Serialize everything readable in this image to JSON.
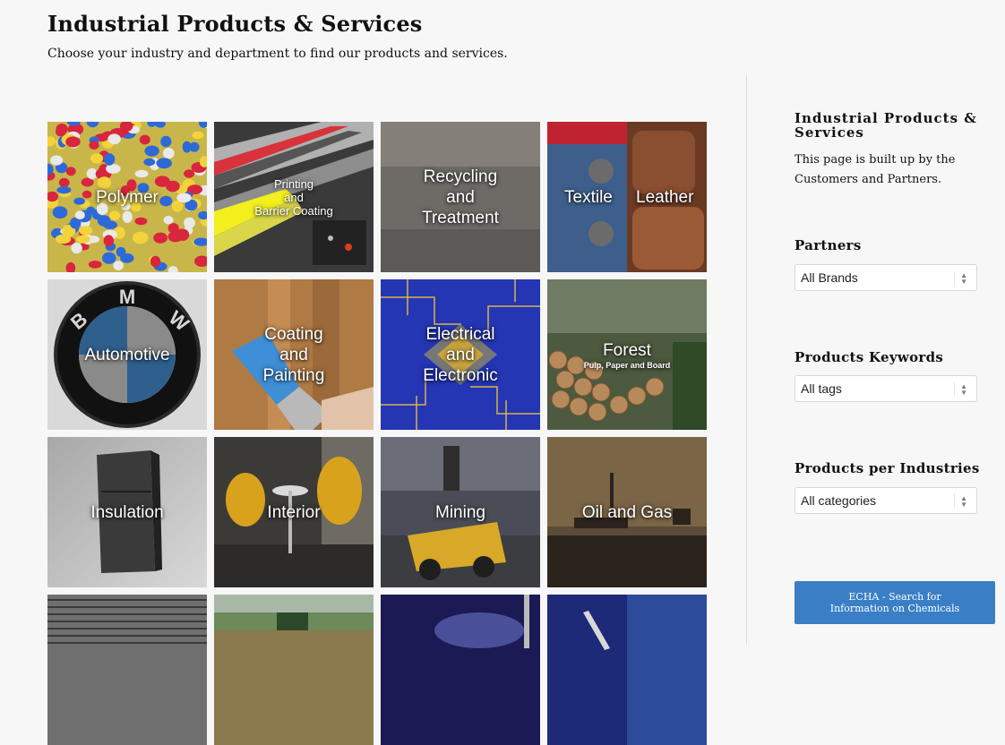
{
  "header": {
    "title": "Industrial Products & Services",
    "subtitle": "Choose your industry and department to find our products and services."
  },
  "tiles": [
    {
      "label": "Polymer"
    },
    {
      "label": "Printing\nand\nBarrier Coating"
    },
    {
      "label": "Recycling\nand\nTreatment"
    },
    {
      "label_left": "Textile",
      "label_right": "Leather"
    },
    {
      "label": "Automotive",
      "logo_text": "BMW"
    },
    {
      "label": "Coating\nand\nPainting"
    },
    {
      "label": "Electrical\nand\nElectronic"
    },
    {
      "label": "Forest",
      "sublabel": "Pulp, Paper and Board"
    },
    {
      "label": "Insulation"
    },
    {
      "label": "Interior"
    },
    {
      "label": "Mining"
    },
    {
      "label": "Oil and Gas"
    },
    {
      "label": ""
    },
    {
      "label": ""
    },
    {
      "label": ""
    },
    {
      "label": ""
    }
  ],
  "sidebar": {
    "title": "Industrial Products & Services",
    "description": "This page is built up by the Customers and Partners.",
    "partners_label": "Partners",
    "partners_value": "All Brands",
    "keywords_label": "Products Keywords",
    "keywords_value": "All tags",
    "industries_label": "Products per Industries",
    "industries_value": "All categories",
    "echa_button": "ECHA - Search for Information on Chemicals"
  },
  "colors": {
    "button": "#3a7fc6",
    "page_background": "#f7f7f7"
  }
}
